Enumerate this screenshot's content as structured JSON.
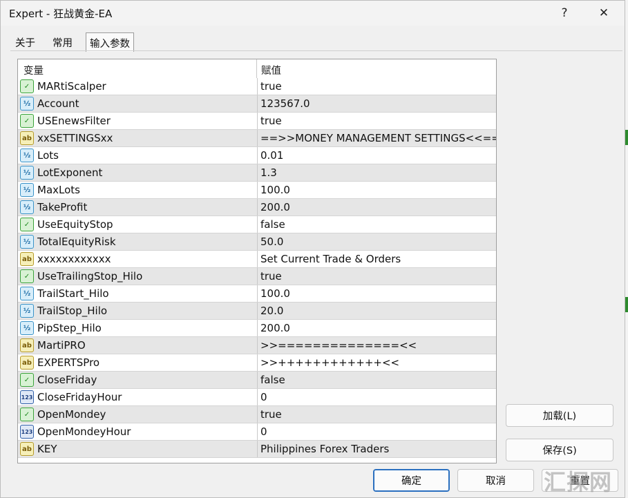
{
  "window": {
    "title": "Expert - 狂战黄金-EA",
    "help_label": "?",
    "close_label": "✕"
  },
  "tabs": [
    {
      "label": "关于",
      "active": false
    },
    {
      "label": "常用",
      "active": false
    },
    {
      "label": "输入参数",
      "active": true
    }
  ],
  "grid": {
    "columns": {
      "variable": "变量",
      "value": "赋值"
    },
    "rows": [
      {
        "type": "bool",
        "icon": "bool-icon",
        "name": "MARtiScalper",
        "value": "true"
      },
      {
        "type": "dbl",
        "icon": "double-icon",
        "name": "Account",
        "value": "123567.0"
      },
      {
        "type": "bool",
        "icon": "bool-icon",
        "name": "USEnewsFilter",
        "value": "true"
      },
      {
        "type": "str",
        "icon": "string-icon",
        "name": "xxSETTINGSxx",
        "value": "==>>MONEY MANAGEMENT SETTINGS<<=="
      },
      {
        "type": "dbl",
        "icon": "double-icon",
        "name": "Lots",
        "value": "0.01"
      },
      {
        "type": "dbl",
        "icon": "double-icon",
        "name": "LotExponent",
        "value": "1.3"
      },
      {
        "type": "dbl",
        "icon": "double-icon",
        "name": "MaxLots",
        "value": "100.0"
      },
      {
        "type": "dbl",
        "icon": "double-icon",
        "name": "TakeProfit",
        "value": "200.0"
      },
      {
        "type": "bool",
        "icon": "bool-icon",
        "name": "UseEquityStop",
        "value": "false"
      },
      {
        "type": "dbl",
        "icon": "double-icon",
        "name": "TotalEquityRisk",
        "value": "50.0"
      },
      {
        "type": "str",
        "icon": "string-icon",
        "name": "xxxxxxxxxxxx",
        "value": "Set Current Trade & Orders"
      },
      {
        "type": "bool",
        "icon": "bool-icon",
        "name": "UseTrailingStop_Hilo",
        "value": "true"
      },
      {
        "type": "dbl",
        "icon": "double-icon",
        "name": "TrailStart_Hilo",
        "value": "100.0"
      },
      {
        "type": "dbl",
        "icon": "double-icon",
        "name": "TrailStop_Hilo",
        "value": "20.0"
      },
      {
        "type": "dbl",
        "icon": "double-icon",
        "name": "PipStep_Hilo",
        "value": "200.0"
      },
      {
        "type": "str",
        "icon": "string-icon",
        "name": "MartiPRO",
        "value": ">>==============<<"
      },
      {
        "type": "str",
        "icon": "string-icon",
        "name": "EXPERTSPro",
        "value": ">>++++++++++++<<"
      },
      {
        "type": "bool",
        "icon": "bool-icon",
        "name": "CloseFriday",
        "value": "false"
      },
      {
        "type": "int",
        "icon": "integer-icon",
        "name": "CloseFridayHour",
        "value": "0"
      },
      {
        "type": "bool",
        "icon": "bool-icon",
        "name": "OpenMondey",
        "value": "true"
      },
      {
        "type": "int",
        "icon": "integer-icon",
        "name": "OpenMondeyHour",
        "value": "0"
      },
      {
        "type": "str",
        "icon": "string-icon",
        "name": "KEY",
        "value": "Philippines Forex Traders"
      }
    ]
  },
  "icon_glyphs": {
    "bool": "✓",
    "dbl": "½",
    "str": "ab",
    "int": "123"
  },
  "buttons": {
    "load": "加载(L)",
    "save": "保存(S)",
    "ok": "确定",
    "cancel": "取消",
    "reset": "重置"
  },
  "watermark": "汇探网",
  "colors": {
    "accent": "#2a6fbf",
    "row_alt": "#e6e6e6",
    "bool_icon": "#3aa33a",
    "string_icon": "#b59a2a"
  }
}
